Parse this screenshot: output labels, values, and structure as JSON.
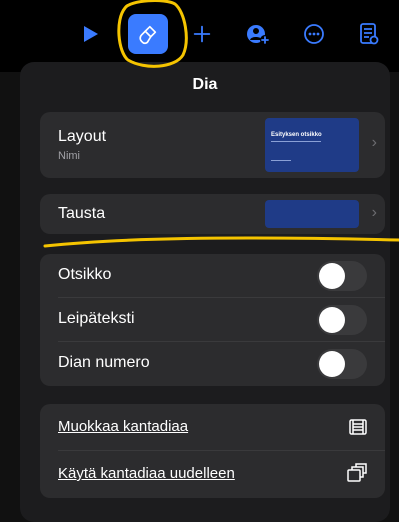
{
  "topbar": {
    "icons": [
      "play-icon",
      "paintbrush-icon",
      "plus-icon",
      "collaborate-icon",
      "more-icon",
      "document-icon"
    ]
  },
  "panel": {
    "title": "Dia",
    "layout": {
      "label": "Layout",
      "sublabel": "Nimi"
    },
    "thumb": {
      "title": "Esityksen otsikko",
      "subtitle": "",
      "footer": ""
    },
    "background": {
      "label": "Tausta"
    },
    "toggles": [
      {
        "label": "Otsikko",
        "on": false
      },
      {
        "label": "Leipäteksti",
        "on": false
      },
      {
        "label": "Dian numero",
        "on": false
      }
    ],
    "actions": [
      {
        "label": "Muokkaa kantadiaa"
      },
      {
        "label": "Käytä kantadiaa uudelleen"
      }
    ]
  },
  "colors": {
    "accent": "#3a7bff",
    "annotation": "#f5c400",
    "thumb": "#1f3b87"
  }
}
